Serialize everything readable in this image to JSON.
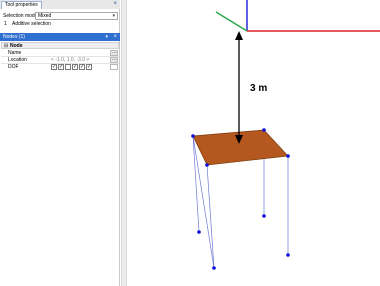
{
  "tool_properties": {
    "tab_title": "Tool properties",
    "selection_model_label": "Selection model",
    "selection_model_value": "Mixed",
    "additive_key": "1",
    "additive_label": "Additive selection"
  },
  "nodes_panel": {
    "title": "Nodes (1)",
    "pin_icon": "pin-icon",
    "close_icon": "close-icon",
    "section": "Node",
    "rows": [
      {
        "key": "Name",
        "value": ""
      },
      {
        "key": "Location",
        "value": "< -1.0, 1.0, -3.0 >"
      },
      {
        "key": "DOF",
        "value": ""
      }
    ],
    "dof_checks": [
      true,
      true,
      false,
      true,
      true,
      true
    ]
  },
  "viewport": {
    "dimension_label": "3 m",
    "colors": {
      "axis_x": "#e0202a",
      "axis_y": "#2aa84a",
      "axis_z": "#2a2ad8",
      "slab": "#b5581f",
      "node": "#1010d8",
      "column": "#6e78d6"
    }
  }
}
